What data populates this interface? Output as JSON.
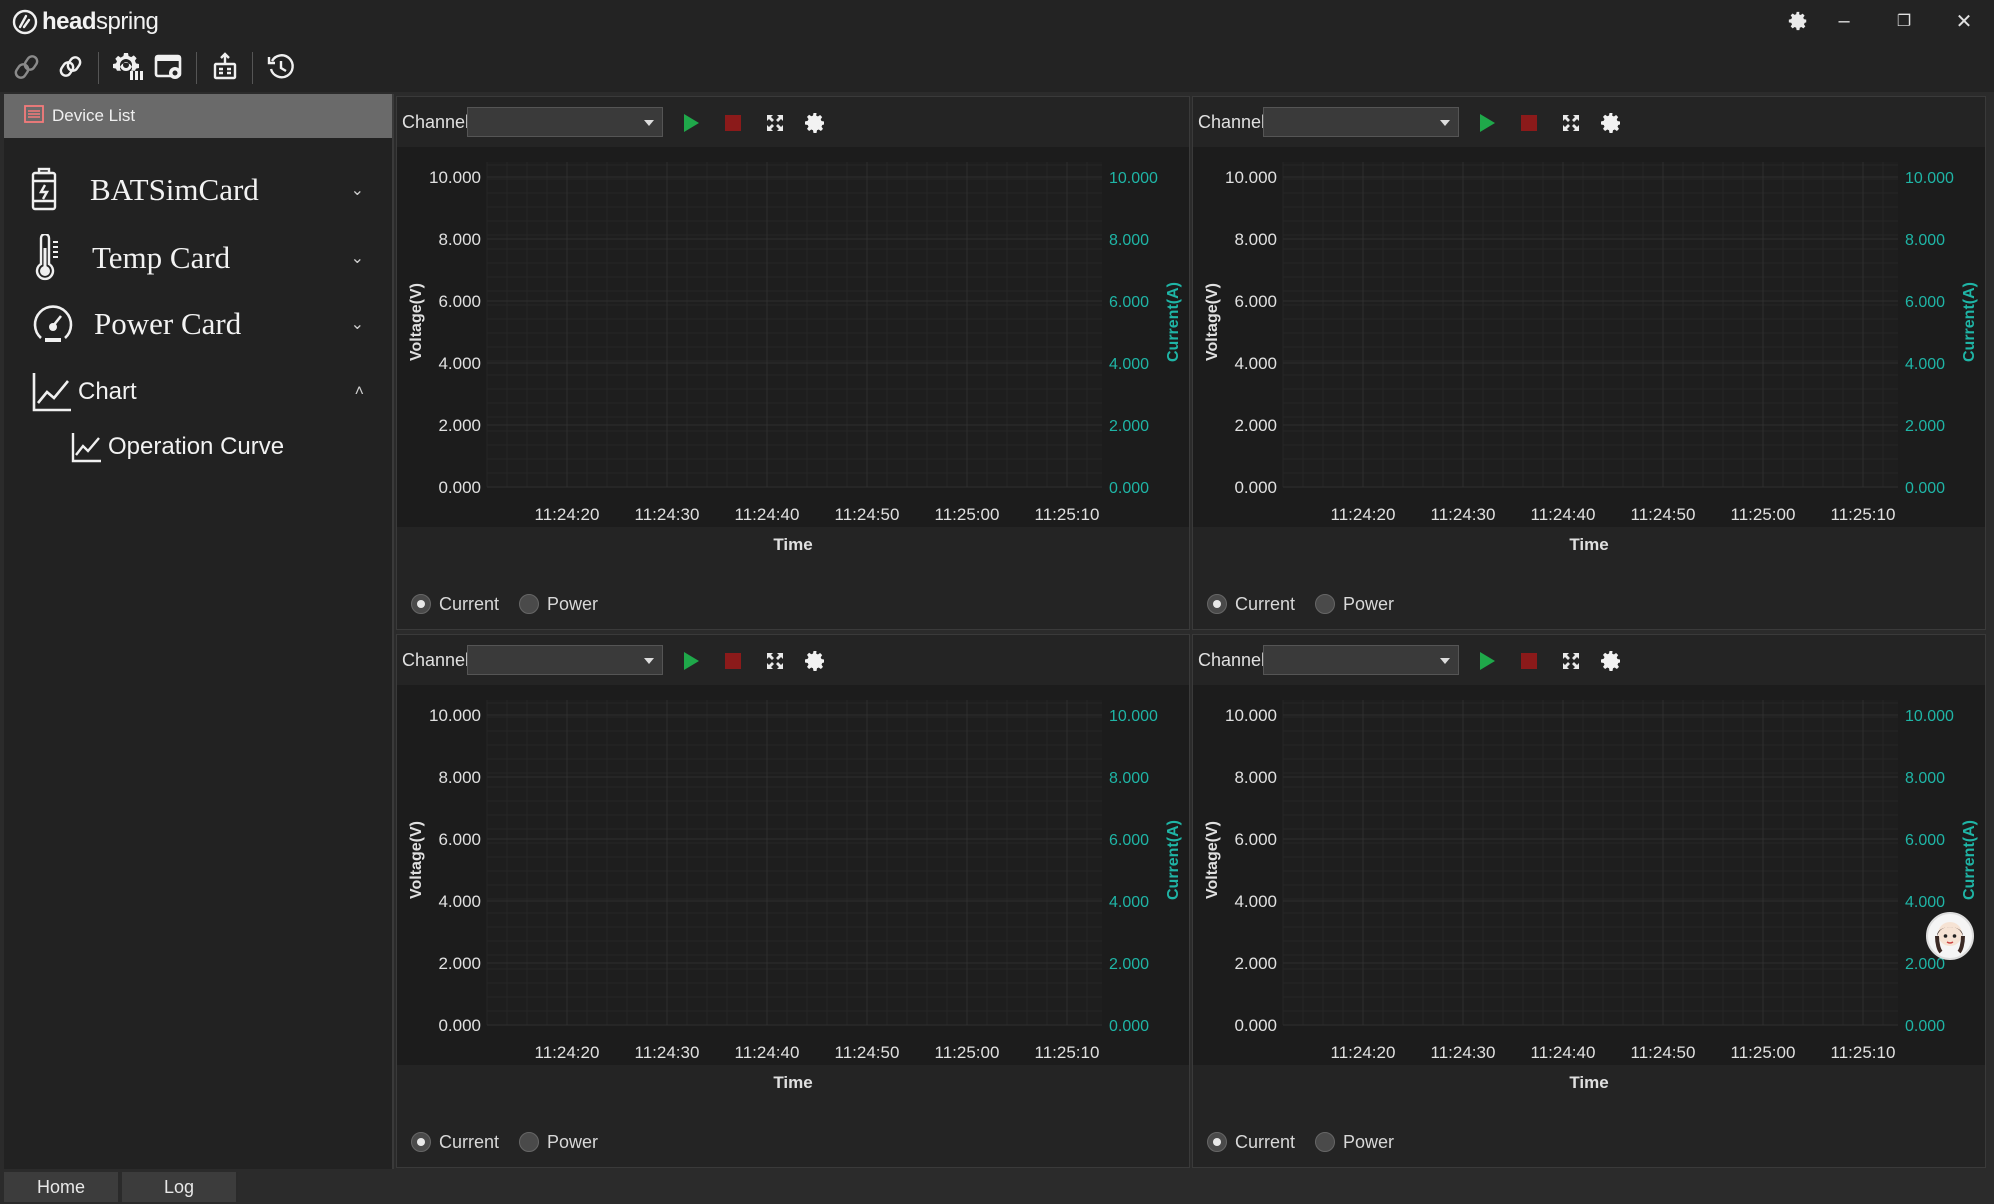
{
  "app": {
    "logo_text_bold": "head",
    "logo_text_rest": "spring"
  },
  "window_controls": {
    "settings_icon": "gear-icon",
    "minimize_glyph": "–",
    "restore_glyph": "❐",
    "close_glyph": "✕"
  },
  "toolbar": {
    "icons": [
      "link-disconnect-icon",
      "link-connect-icon",
      "device-settings-icon",
      "device-config-icon",
      "upgrade-icon",
      "history-icon"
    ]
  },
  "sidebar": {
    "header": "Device List",
    "items": [
      {
        "label": "BATSimCard",
        "icon": "battery-icon",
        "expanded": false
      },
      {
        "label": "Temp Card",
        "icon": "thermometer-icon",
        "expanded": false
      },
      {
        "label": "Power Card",
        "icon": "gauge-icon",
        "expanded": false
      },
      {
        "label": "Chart",
        "icon": "chart-icon",
        "expanded": true
      },
      {
        "label": "Operation Curve",
        "icon": "chart-icon",
        "child": true
      }
    ]
  },
  "panels": [
    {
      "channel_label": "Channel",
      "channel_value": "",
      "radio_current": "Current",
      "radio_power": "Power",
      "selected": "Current"
    },
    {
      "channel_label": "Channel",
      "channel_value": "",
      "radio_current": "Current",
      "radio_power": "Power",
      "selected": "Current"
    },
    {
      "channel_label": "Channel",
      "channel_value": "",
      "radio_current": "Current",
      "radio_power": "Power",
      "selected": "Current"
    },
    {
      "channel_label": "Channel",
      "channel_value": "",
      "radio_current": "Current",
      "radio_power": "Power",
      "selected": "Current"
    }
  ],
  "chart_data": [
    {
      "type": "line",
      "title": "",
      "xlabel": "Time",
      "ylabel": "Voltage(V)",
      "y2label": "Current(A)",
      "x_ticks": [
        "11:24:20",
        "11:24:30",
        "11:24:40",
        "11:24:50",
        "11:25:00",
        "11:25:10"
      ],
      "y_ticks": [
        "0.000",
        "2.000",
        "4.000",
        "6.000",
        "8.000",
        "10.000"
      ],
      "y2_ticks": [
        "0.000",
        "2.000",
        "4.000",
        "6.000",
        "8.000",
        "10.000"
      ],
      "ylim": [
        0,
        10
      ],
      "y2lim": [
        0,
        10
      ],
      "grid": true,
      "series": []
    },
    {
      "type": "line",
      "title": "",
      "xlabel": "Time",
      "ylabel": "Voltage(V)",
      "y2label": "Current(A)",
      "x_ticks": [
        "11:24:20",
        "11:24:30",
        "11:24:40",
        "11:24:50",
        "11:25:00",
        "11:25:10"
      ],
      "y_ticks": [
        "0.000",
        "2.000",
        "4.000",
        "6.000",
        "8.000",
        "10.000"
      ],
      "y2_ticks": [
        "0.000",
        "2.000",
        "4.000",
        "6.000",
        "8.000",
        "10.000"
      ],
      "ylim": [
        0,
        10
      ],
      "y2lim": [
        0,
        10
      ],
      "grid": true,
      "series": []
    },
    {
      "type": "line",
      "title": "",
      "xlabel": "Time",
      "ylabel": "Voltage(V)",
      "y2label": "Current(A)",
      "x_ticks": [
        "11:24:20",
        "11:24:30",
        "11:24:40",
        "11:24:50",
        "11:25:00",
        "11:25:10"
      ],
      "y_ticks": [
        "0.000",
        "2.000",
        "4.000",
        "6.000",
        "8.000",
        "10.000"
      ],
      "y2_ticks": [
        "0.000",
        "2.000",
        "4.000",
        "6.000",
        "8.000",
        "10.000"
      ],
      "ylim": [
        0,
        10
      ],
      "y2lim": [
        0,
        10
      ],
      "grid": true,
      "series": []
    },
    {
      "type": "line",
      "title": "",
      "xlabel": "Time",
      "ylabel": "Voltage(V)",
      "y2label": "Current(A)",
      "x_ticks": [
        "11:24:20",
        "11:24:30",
        "11:24:40",
        "11:24:50",
        "11:25:00",
        "11:25:10"
      ],
      "y_ticks": [
        "0.000",
        "2.000",
        "4.000",
        "6.000",
        "8.000",
        "10.000"
      ],
      "y2_ticks": [
        "0.000",
        "2.000",
        "4.000",
        "6.000",
        "8.000",
        "10.000"
      ],
      "ylim": [
        0,
        10
      ],
      "y2lim": [
        0,
        10
      ],
      "grid": true,
      "series": []
    }
  ],
  "colors": {
    "play": "#1fa84a",
    "stop": "#8b1a1a",
    "y2_axis": "#1fb5a6",
    "axis_text": "#e0e0e0",
    "plot_bg": "#1c1c1c"
  },
  "bottom_tabs": [
    "Home",
    "Log"
  ]
}
